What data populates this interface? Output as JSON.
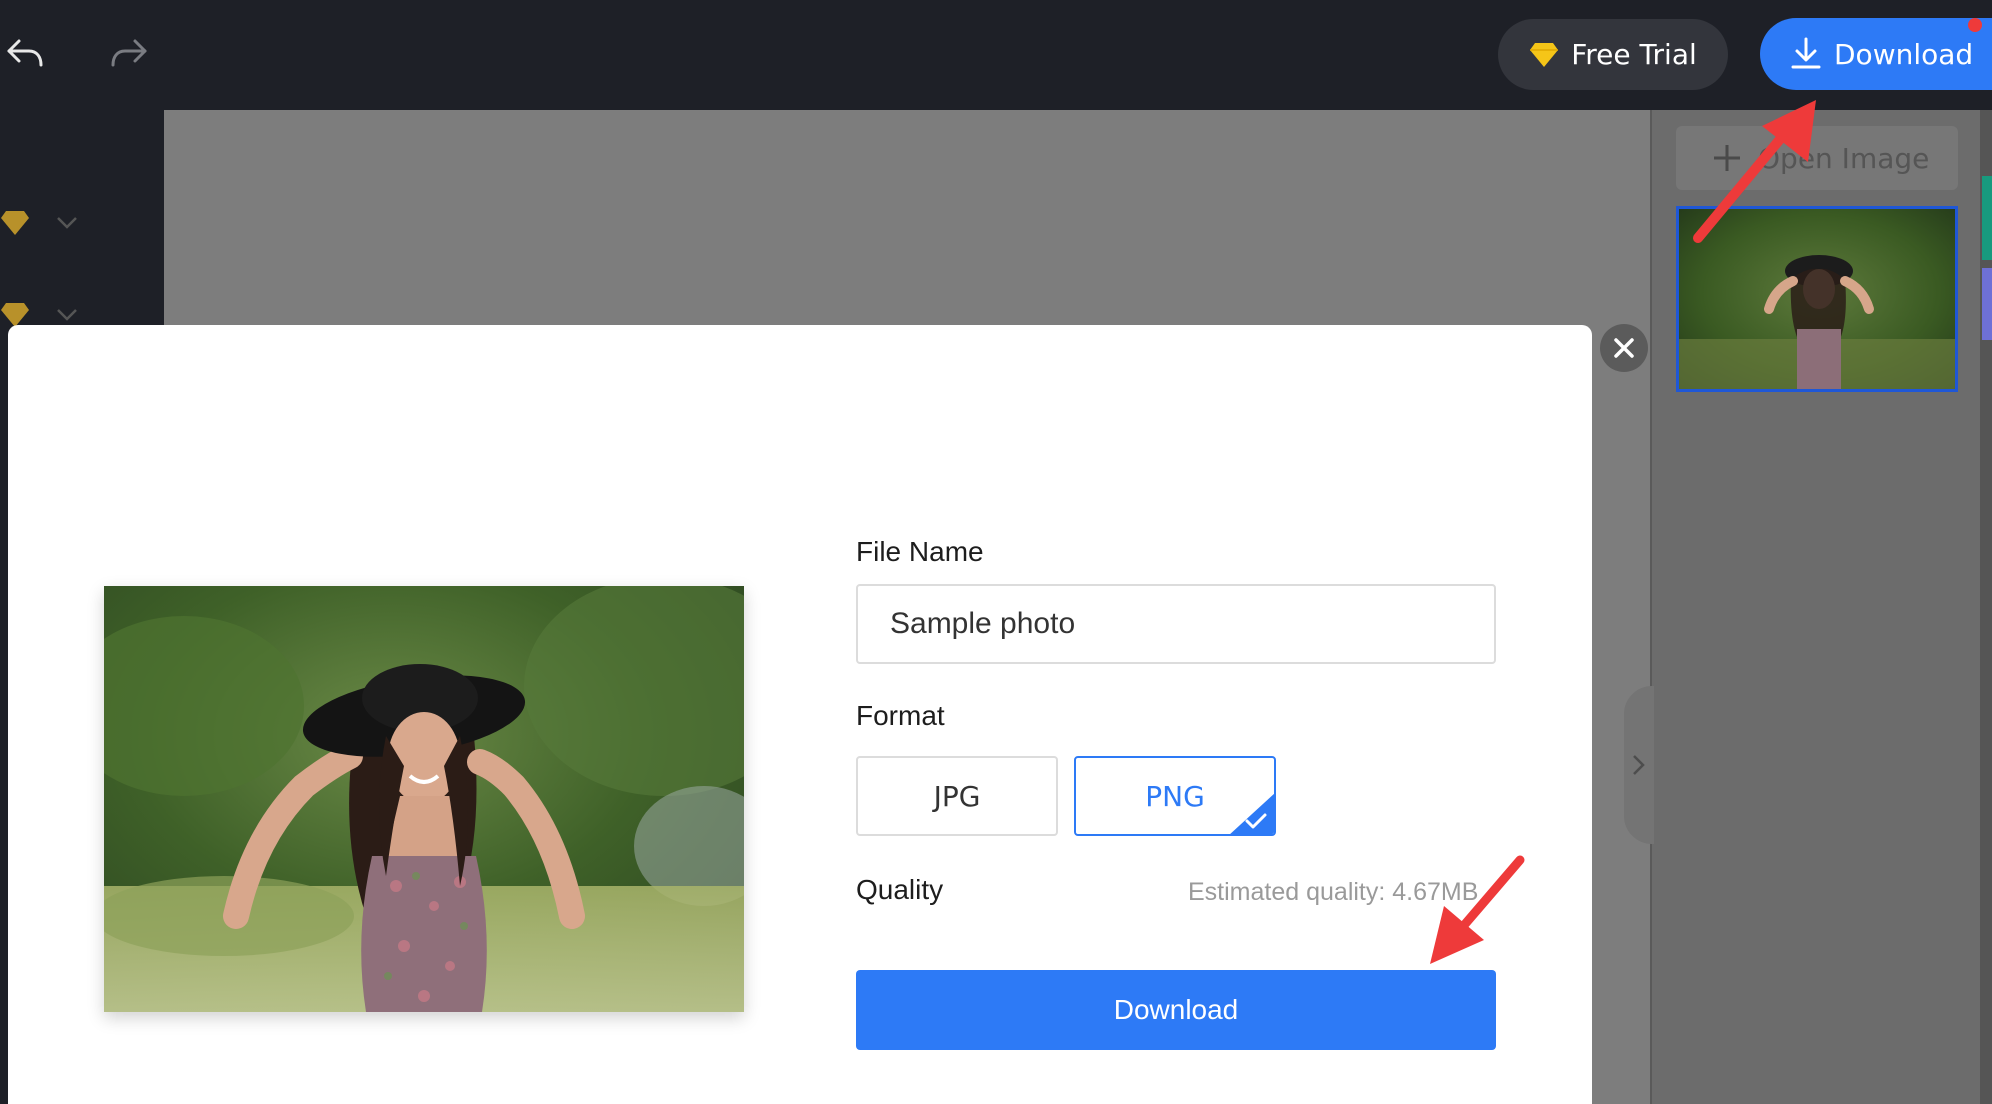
{
  "topbar": {
    "free_trial_label": "Free Trial",
    "download_label": "Download"
  },
  "right_panel": {
    "open_image_label": "Open Image"
  },
  "dialog": {
    "file_name_label": "File Name",
    "file_name_value": "Sample photo",
    "format_label": "Format",
    "formats": [
      "JPG",
      "PNG"
    ],
    "selected_format": "PNG",
    "quality_label": "Quality",
    "estimated_quality": "Estimated quality: 4.67MB",
    "download_label": "Download"
  },
  "colors": {
    "accent": "#2d7af6",
    "topbar": "#1e2027",
    "annotation_arrow": "#ee3a3a",
    "premium_gem": "#f5c518"
  },
  "icons": [
    "undo-icon",
    "redo-icon",
    "gem-icon",
    "download-icon",
    "plus-icon",
    "close-icon",
    "chevron-right-icon",
    "checkmark-icon"
  ]
}
